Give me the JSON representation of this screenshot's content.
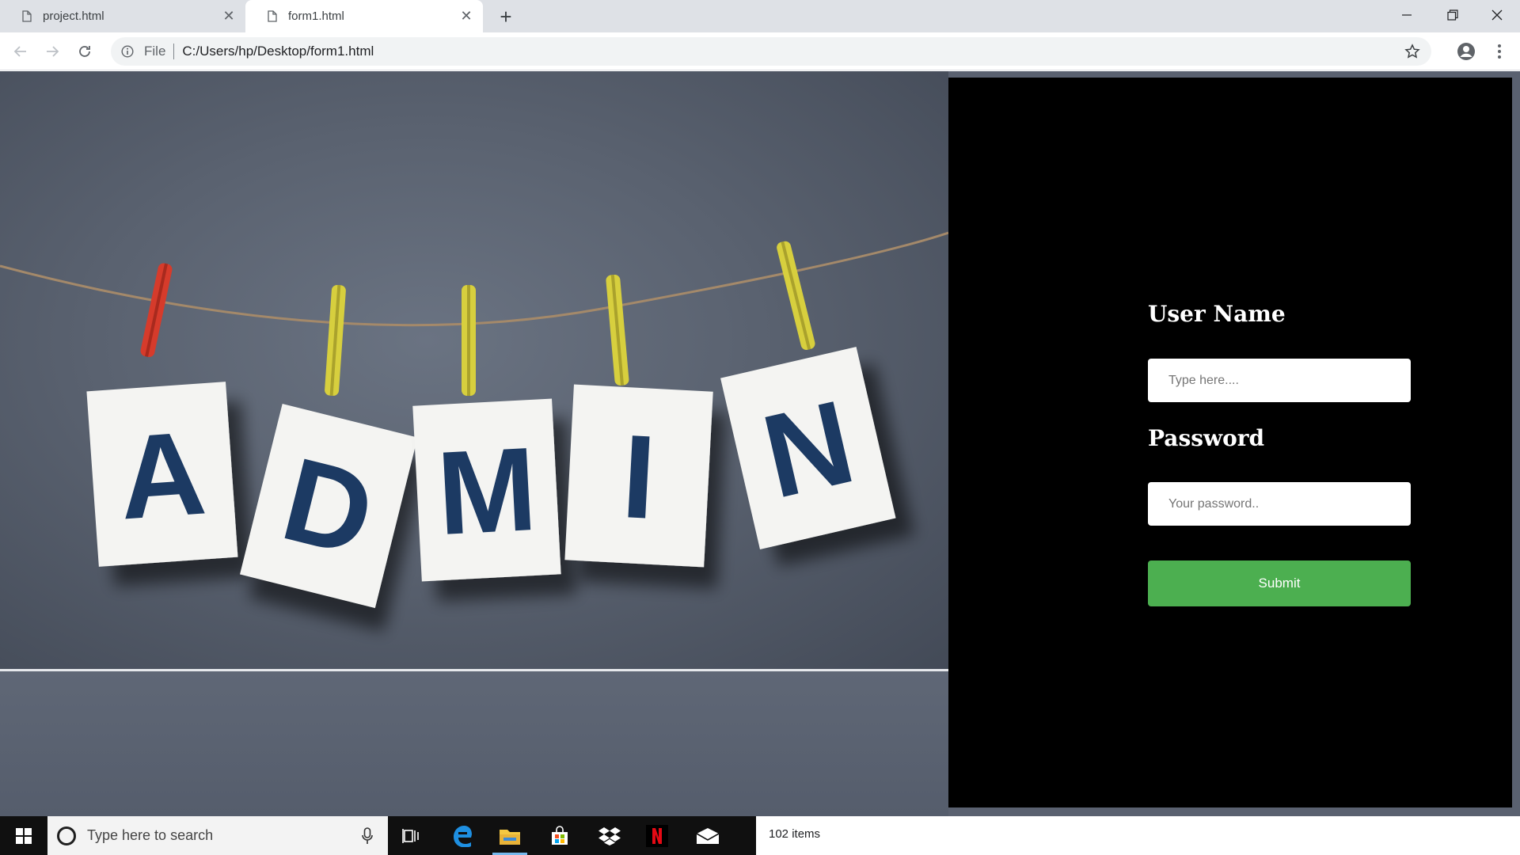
{
  "browser": {
    "tabs": [
      {
        "title": "project.html",
        "active": false
      },
      {
        "title": "form1.html",
        "active": true
      }
    ],
    "new_tab_glyph": "+",
    "address": {
      "scheme_label": "File",
      "url": "C:/Users/hp/Desktop/form1.html"
    },
    "icons": [
      "back-icon",
      "forward-icon",
      "reload-icon",
      "info-icon",
      "star-icon",
      "profile-icon",
      "menu-icon",
      "minimize-icon",
      "restore-icon",
      "close-icon"
    ]
  },
  "page": {
    "image_letters": [
      "A",
      "D",
      "M",
      "I",
      "N"
    ],
    "form": {
      "username_label": "User Name",
      "username_placeholder": "Type here....",
      "password_label": "Password",
      "password_placeholder": "Your password..",
      "submit_label": "Submit"
    },
    "colors": {
      "panel": "#000000",
      "submit": "#4caf50",
      "letters": "#1c3a63"
    }
  },
  "taskbar": {
    "search_placeholder": "Type here to search",
    "explorer_status": "102 items",
    "apps": [
      "windows-start-icon",
      "cortana-icon",
      "microphone-icon",
      "task-view-icon",
      "edge-icon",
      "file-explorer-icon",
      "store-icon",
      "dropbox-icon",
      "netflix-icon",
      "mail-icon"
    ]
  }
}
